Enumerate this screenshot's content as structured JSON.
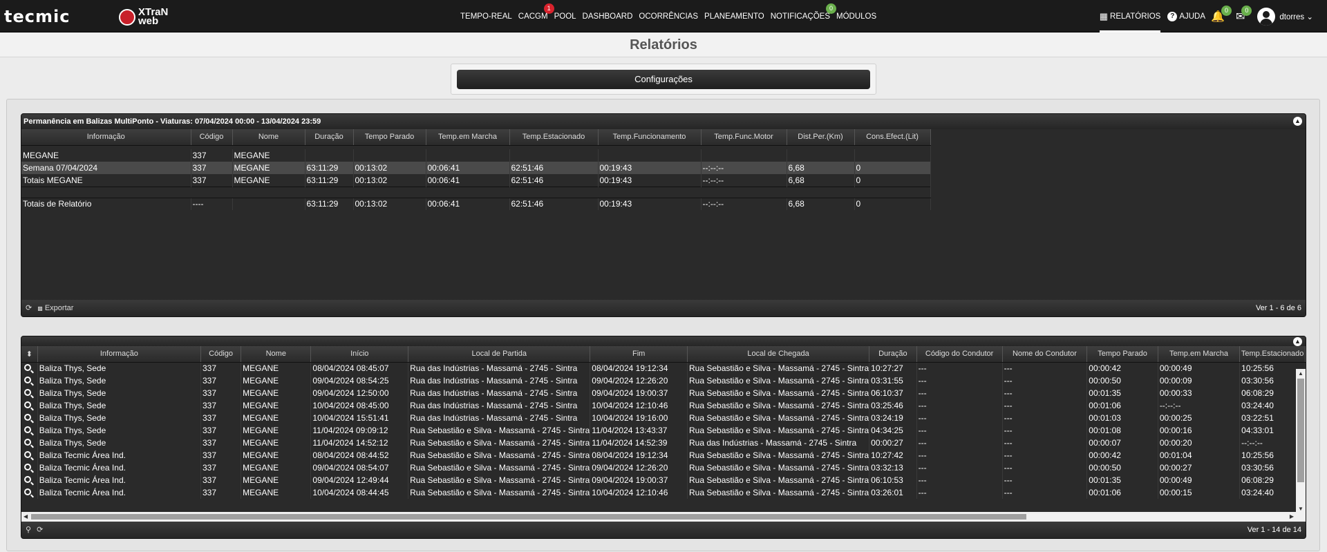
{
  "header": {
    "logo_text": "tecmic",
    "brand_text": "XTraN web",
    "nav": [
      {
        "label": "TEMPO-REAL",
        "badge": ""
      },
      {
        "label": "CACGM",
        "badge": "1"
      },
      {
        "label": "POOL",
        "badge": ""
      },
      {
        "label": "DASHBOARD",
        "badge": ""
      },
      {
        "label": "OCORRÊNCIAS",
        "badge": ""
      },
      {
        "label": "PLANEAMENTO",
        "badge": ""
      },
      {
        "label": "NOTIFICAÇÕES",
        "badge": "0"
      },
      {
        "label": "MÓDULOS",
        "badge": ""
      }
    ],
    "right": {
      "reports_label": "RELATÓRIOS",
      "help_label": "AJUDA",
      "bell_badge": "0",
      "mail_badge": "0",
      "username": "dtorres"
    }
  },
  "page_title": "Relatórios",
  "config_button": "Configurações",
  "summary": {
    "caption": "Permanência em Balizas MultiPonto - Viaturas: 07/04/2024 00:00 - 13/04/2024 23:59",
    "columns": [
      "Informação",
      "Código",
      "Nome",
      "Duração",
      "Tempo Parado",
      "Temp.em Marcha",
      "Temp.Estacionado",
      "Temp.Funcionamento",
      "Temp.Func.Motor",
      "Dist.Per.(Km)",
      "Cons.Efect.(Lit)"
    ],
    "rows": [
      [
        "MEGANE",
        "337",
        "MEGANE",
        "",
        "",
        "",
        "",
        "",
        "",
        "",
        ""
      ],
      [
        "Semana 07/04/2024",
        "337",
        "MEGANE",
        "63:11:29",
        "00:13:02",
        "00:06:41",
        "62:51:46",
        "00:19:43",
        "--:--:--",
        "6,68",
        "0"
      ],
      [
        "Totais MEGANE",
        "337",
        "MEGANE",
        "63:11:29",
        "00:13:02",
        "00:06:41",
        "62:51:46",
        "00:19:43",
        "--:--:--",
        "6,68",
        "0"
      ]
    ],
    "total_row": [
      "Totais de Relatório",
      "----",
      "",
      "63:11:29",
      "00:13:02",
      "00:06:41",
      "62:51:46",
      "00:19:43",
      "--:--:--",
      "6,68",
      "0"
    ],
    "export_label": "Exportar",
    "pager_text": "Ver 1 - 6 de 6"
  },
  "detail": {
    "columns": [
      "Informação",
      "Código",
      "Nome",
      "Início",
      "Local de Partida",
      "Fim",
      "Local de Chegada",
      "Duração",
      "Código do Condutor",
      "Nome do Condutor",
      "Tempo Parado",
      "Temp.em Marcha",
      "Temp.Estacionado"
    ],
    "rows": [
      [
        "Baliza Thys, Sede",
        "337",
        "MEGANE",
        "08/04/2024 08:45:07",
        "Rua das Indústrias - Massamá - 2745 - Sintra",
        "08/04/2024 19:12:34",
        "Rua Sebastião e Silva - Massamá - 2745 - Sintra",
        "10:27:27",
        "---",
        "---",
        "00:00:42",
        "00:00:49",
        "10:25:56"
      ],
      [
        "Baliza Thys, Sede",
        "337",
        "MEGANE",
        "09/04/2024 08:54:25",
        "Rua das Indústrias - Massamá - 2745 - Sintra",
        "09/04/2024 12:26:20",
        "Rua Sebastião e Silva - Massamá - 2745 - Sintra",
        "03:31:55",
        "---",
        "---",
        "00:00:50",
        "00:00:09",
        "03:30:56"
      ],
      [
        "Baliza Thys, Sede",
        "337",
        "MEGANE",
        "09/04/2024 12:50:00",
        "Rua das Indústrias - Massamá - 2745 - Sintra",
        "09/04/2024 19:00:37",
        "Rua Sebastião e Silva - Massamá - 2745 - Sintra",
        "06:10:37",
        "---",
        "---",
        "00:01:35",
        "00:00:33",
        "06:08:29"
      ],
      [
        "Baliza Thys, Sede",
        "337",
        "MEGANE",
        "10/04/2024 08:45:00",
        "Rua das Indústrias - Massamá - 2745 - Sintra",
        "10/04/2024 12:10:46",
        "Rua Sebastião e Silva - Massamá - 2745 - Sintra",
        "03:25:46",
        "---",
        "---",
        "00:01:06",
        "--:--:--",
        "03:24:40"
      ],
      [
        "Baliza Thys, Sede",
        "337",
        "MEGANE",
        "10/04/2024 15:51:41",
        "Rua das Indústrias - Massamá - 2745 - Sintra",
        "10/04/2024 19:16:00",
        "Rua Sebastião e Silva - Massamá - 2745 - Sintra",
        "03:24:19",
        "---",
        "---",
        "00:01:03",
        "00:00:25",
        "03:22:51"
      ],
      [
        "Baliza Thys, Sede",
        "337",
        "MEGANE",
        "11/04/2024 09:09:12",
        "Rua Sebastião e Silva - Massamá - 2745 - Sintra",
        "11/04/2024 13:43:37",
        "Rua Sebastião e Silva - Massamá - 2745 - Sintra",
        "04:34:25",
        "---",
        "---",
        "00:01:08",
        "00:00:16",
        "04:33:01"
      ],
      [
        "Baliza Thys, Sede",
        "337",
        "MEGANE",
        "11/04/2024 14:52:12",
        "Rua Sebastião e Silva - Massamá - 2745 - Sintra",
        "11/04/2024 14:52:39",
        "Rua das Indústrias - Massamá - 2745 - Sintra",
        "00:00:27",
        "---",
        "---",
        "00:00:07",
        "00:00:20",
        "--:--:--"
      ],
      [
        "Baliza Tecmic Área Ind.",
        "337",
        "MEGANE",
        "08/04/2024 08:44:52",
        "Rua Sebastião e Silva - Massamá - 2745 - Sintra",
        "08/04/2024 19:12:34",
        "Rua Sebastião e Silva - Massamá - 2745 - Sintra",
        "10:27:42",
        "---",
        "---",
        "00:00:42",
        "00:01:04",
        "10:25:56"
      ],
      [
        "Baliza Tecmic Área Ind.",
        "337",
        "MEGANE",
        "09/04/2024 08:54:07",
        "Rua Sebastião e Silva - Massamá - 2745 - Sintra",
        "09/04/2024 12:26:20",
        "Rua Sebastião e Silva - Massamá - 2745 - Sintra",
        "03:32:13",
        "---",
        "---",
        "00:00:50",
        "00:00:27",
        "03:30:56"
      ],
      [
        "Baliza Tecmic Área Ind.",
        "337",
        "MEGANE",
        "09/04/2024 12:49:44",
        "Rua Sebastião e Silva - Massamá - 2745 - Sintra",
        "09/04/2024 19:00:37",
        "Rua Sebastião e Silva - Massamá - 2745 - Sintra",
        "06:10:53",
        "---",
        "---",
        "00:01:35",
        "00:00:49",
        "06:08:29"
      ],
      [
        "Baliza Tecmic Área Ind.",
        "337",
        "MEGANE",
        "10/04/2024 08:44:45",
        "Rua Sebastião e Silva - Massamá - 2745 - Sintra",
        "10/04/2024 12:10:46",
        "Rua Sebastião e Silva - Massamá - 2745 - Sintra",
        "03:26:01",
        "---",
        "---",
        "00:01:06",
        "00:00:15",
        "03:24:40"
      ]
    ],
    "pager_text": "Ver 1 - 14 de 14"
  }
}
